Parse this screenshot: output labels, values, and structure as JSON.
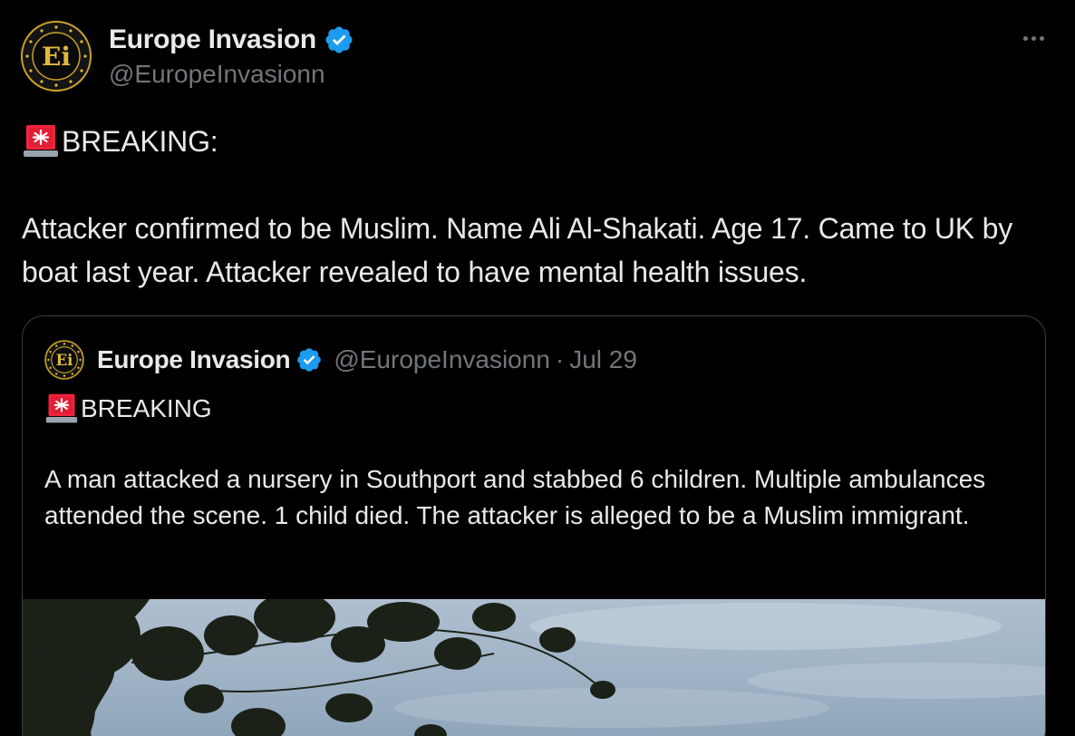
{
  "tweet": {
    "author": {
      "display_name": "Europe Invasion",
      "handle": "@EuropeInvasionn",
      "avatar_text": "Ei",
      "verified": true
    },
    "more_icon": "more-horizontal-icon",
    "breaking_label": "BREAKING:",
    "body": "Attacker confirmed to be Muslim. Name Ali Al-Shakati. Age 17. Came to UK by boat last year. Attacker revealed to have mental health issues."
  },
  "quote": {
    "author": {
      "display_name": "Europe Invasion",
      "handle": "@EuropeInvasionn",
      "separator": "·",
      "date": "Jul 29",
      "avatar_text": "Ei"
    },
    "breaking_label": "BREAKING",
    "body": "A man attacked a nursery in Southport and stabbed 6 children. Multiple ambulances attended the scene. 1 child died. The attacker is alleged to be a Muslim immigrant.",
    "media_icon": "photo-trees-sky"
  },
  "colors": {
    "background": "#000000",
    "text": "#e7e9ea",
    "secondary": "#71767b",
    "verified": "#1d9bf0",
    "border": "#3a3e42",
    "siren_red": "#f4233d"
  }
}
